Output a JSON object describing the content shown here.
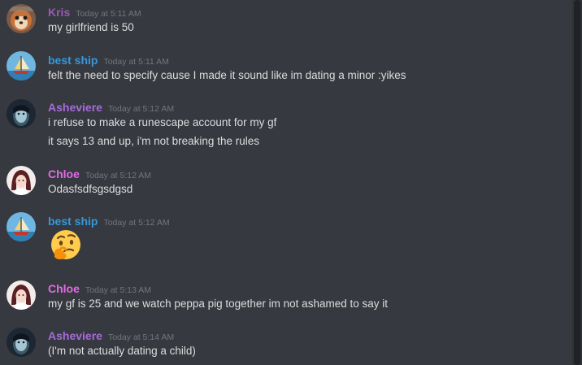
{
  "colors": {
    "background": "#36393f",
    "kris": "#9b59b6",
    "best_ship": "#3498db",
    "asheviere": "#a66bd8",
    "chloe": "#e46ae6",
    "timestamp": "#72767d",
    "text": "#dcddde"
  },
  "messages": [
    {
      "author": "Kris",
      "timestamp": "Today at 5:11 AM",
      "avatar": "squirrel-avatar",
      "lines": [
        "my girlfriend is 50"
      ]
    },
    {
      "author": "best ship",
      "timestamp": "Today at 5:11 AM",
      "avatar": "sailboat-avatar",
      "lines": [
        "felt the need to specify cause I made it sound like im dating a minor :yikes"
      ]
    },
    {
      "author": "Asheviere",
      "timestamp": "Today at 5:12 AM",
      "avatar": "dark-portrait-avatar",
      "lines": [
        "i refuse to make a runescape account for my gf",
        "it says 13 and up, i'm not breaking the rules"
      ]
    },
    {
      "author": "Chloe",
      "timestamp": "Today at 5:12 AM",
      "avatar": "anime-girl-avatar",
      "lines": [
        "Odasfsdfsgsdgsd"
      ]
    },
    {
      "author": "best ship",
      "timestamp": "Today at 5:12 AM",
      "avatar": "sailboat-avatar",
      "emoji": "thinking-face-emoji"
    },
    {
      "author": "Chloe",
      "timestamp": "Today at 5:13 AM",
      "avatar": "anime-girl-avatar",
      "lines": [
        "my gf is 25 and we watch peppa pig together im not ashamed to say it"
      ]
    },
    {
      "author": "Asheviere",
      "timestamp": "Today at 5:14 AM",
      "avatar": "dark-portrait-avatar",
      "lines": [
        "(I'm not actually dating a child)"
      ]
    }
  ]
}
